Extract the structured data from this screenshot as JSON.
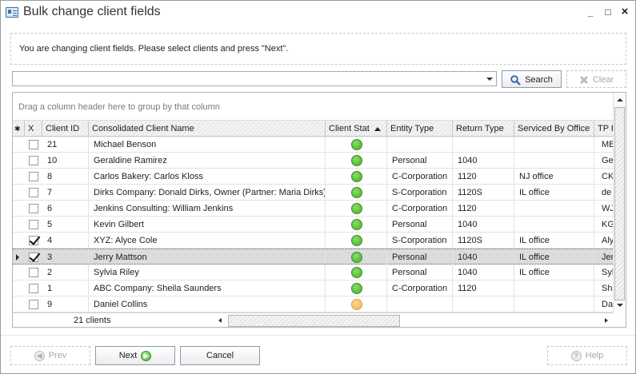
{
  "window": {
    "title": "Bulk change client fields",
    "controls": {
      "minimize": "_",
      "maximize": "□",
      "close": "×"
    }
  },
  "info": {
    "message": "You are changing client fields. Please select clients and press \"Next\"."
  },
  "search": {
    "value": "",
    "search_label": "Search",
    "clear_label": "Clear"
  },
  "grid": {
    "group_hint": "Drag a column header here to group by that column",
    "columns": {
      "star": "✱",
      "x": "X",
      "client_id": "Client ID",
      "name": "Consolidated Client Name",
      "status": "Client Stat",
      "entity": "Entity Type",
      "return": "Return Type",
      "office": "Serviced By Office",
      "tp": "TP F"
    },
    "rows": [
      {
        "checked": false,
        "id": "21",
        "name": "Michael Benson",
        "status": "green",
        "entity": "",
        "return": "",
        "office": "",
        "tp": "MB"
      },
      {
        "checked": false,
        "id": "10",
        "name": "Geraldine Ramirez",
        "status": "green",
        "entity": "Personal",
        "return": "1040",
        "office": "",
        "tp": "Ge"
      },
      {
        "checked": false,
        "id": "8",
        "name": "Carlos Bakery: Carlos Kloss",
        "status": "green",
        "entity": "C-Corporation",
        "return": "1120",
        "office": "NJ office",
        "tp": "CK"
      },
      {
        "checked": false,
        "id": "7",
        "name": "Dirks Company: Donald Dirks, Owner (Partner: Maria Dirks)",
        "status": "green",
        "entity": "S-Corporation",
        "return": "1120S",
        "office": "IL office",
        "tp": "de"
      },
      {
        "checked": false,
        "id": "6",
        "name": "Jenkins Consulting: William Jenkins",
        "status": "green",
        "entity": "C-Corporation",
        "return": "1120",
        "office": "",
        "tp": "WJ"
      },
      {
        "checked": false,
        "id": "5",
        "name": "Kevin Gilbert",
        "status": "green",
        "entity": "Personal",
        "return": "1040",
        "office": "",
        "tp": "KG"
      },
      {
        "checked": true,
        "id": "4",
        "name": "XYZ: Alyce Cole",
        "status": "green",
        "entity": "S-Corporation",
        "return": "1120S",
        "office": "IL office",
        "tp": "Aly"
      },
      {
        "checked": true,
        "id": "3",
        "name": "Jerry Mattson",
        "status": "green",
        "entity": "Personal",
        "return": "1040",
        "office": "IL office",
        "tp": "Jer",
        "selected": true
      },
      {
        "checked": false,
        "id": "2",
        "name": "Sylvia Riley",
        "status": "green",
        "entity": "Personal",
        "return": "1040",
        "office": "IL office",
        "tp": "Syl"
      },
      {
        "checked": false,
        "id": "1",
        "name": "ABC Company: Sheila Saunders",
        "status": "green",
        "entity": "C-Corporation",
        "return": "1120",
        "office": "",
        "tp": "She"
      },
      {
        "checked": false,
        "id": "9",
        "name": "Daniel Collins",
        "status": "orange",
        "entity": "",
        "return": "",
        "office": "",
        "tp": "Da"
      }
    ],
    "footer_count": "21 clients"
  },
  "buttons": {
    "prev": "Prev",
    "next": "Next",
    "cancel": "Cancel",
    "help": "Help"
  },
  "colors": {
    "status_green": "#5cc23a",
    "status_orange": "#f5c26a"
  }
}
